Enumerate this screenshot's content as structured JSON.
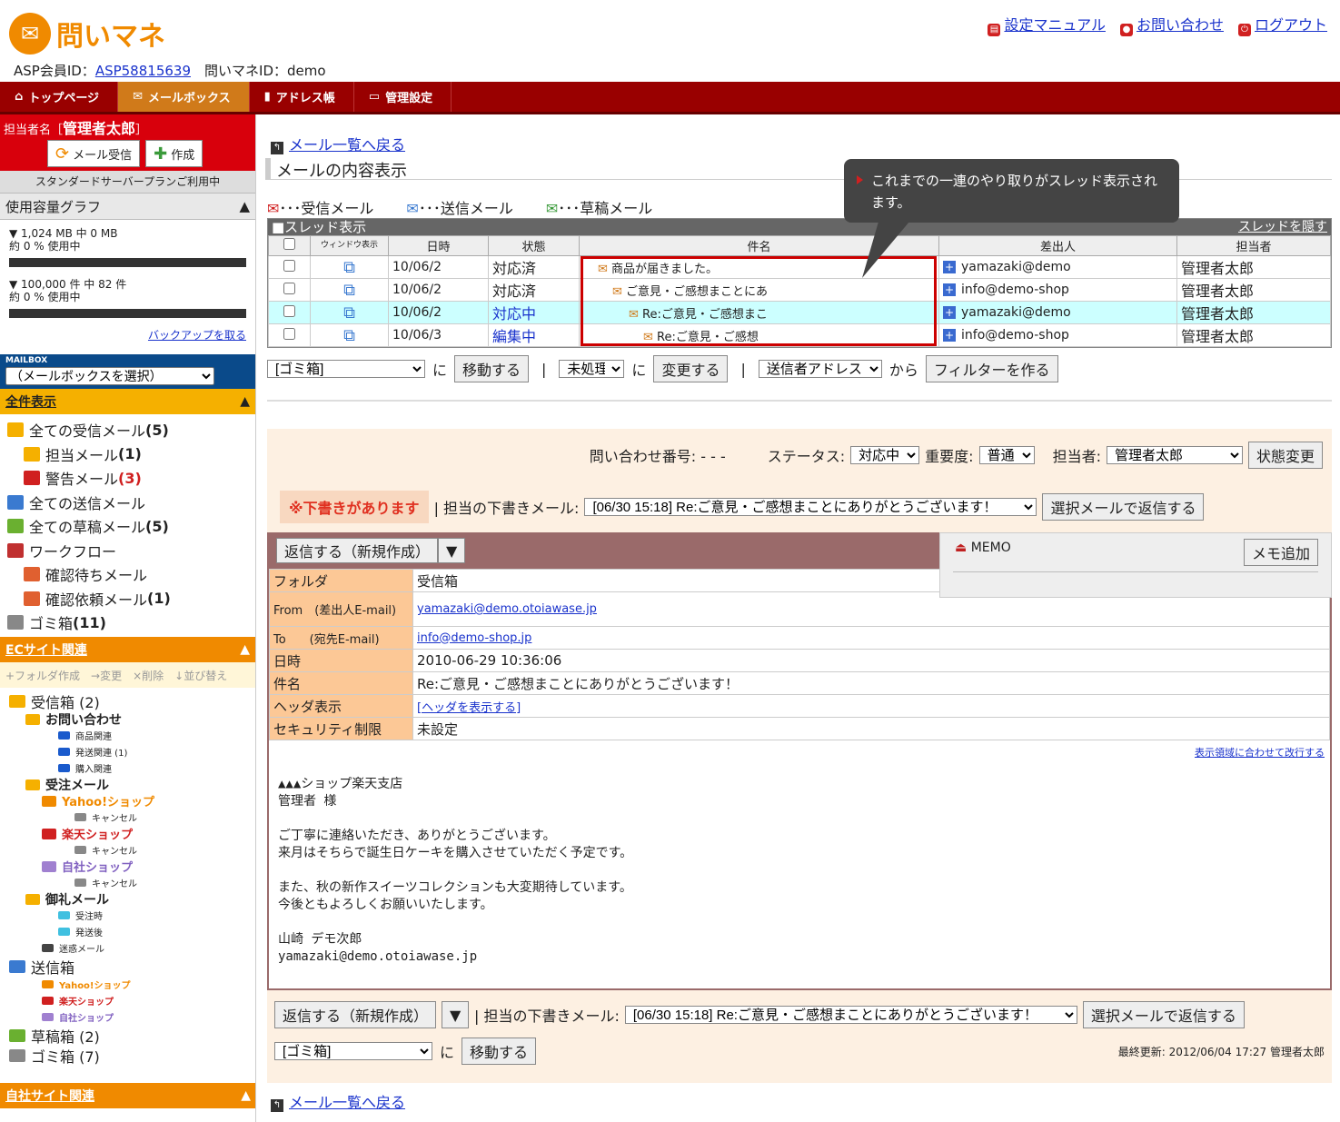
{
  "header": {
    "logo": "問いマネ",
    "asp_label": "ASP会員ID：",
    "asp_id": "ASP58815639",
    "toi_label": "問いマネID：demo",
    "links": [
      "設定マニュアル",
      "お問い合わせ",
      "ログアウト"
    ]
  },
  "nav": [
    "トップページ",
    "メールボックス",
    "アドレス帳",
    "管理設定"
  ],
  "side": {
    "user_label": "担当者名［",
    "user": "管理者太郎",
    "user_end": "］",
    "recv": "メール受信",
    "compose": "作成",
    "plan": "スタンダードサーバープランご利用中",
    "usage_title": "使用容量グラフ",
    "u1a": "▼ 1,024 MB 中 0 MB",
    "u1b": "約 0 % 使用中",
    "u2a": "▼ 100,000 件 中 82 件",
    "u2b": "約 0 % 使用中",
    "backup": "バックアップを取る",
    "mailbox": "MAILBOX",
    "mailbox_sel": "（メールボックスを選択）",
    "all": "全件表示",
    "tree1": [
      {
        "l": "全ての受信メール",
        "c": "(5)",
        "ind": 0,
        "col": "#f5b000"
      },
      {
        "l": "担当メール",
        "c": "(1)",
        "ind": 1,
        "col": "#f5b000"
      },
      {
        "l": "警告メール",
        "c": "(3)",
        "ind": 1,
        "col": "#d02020",
        "red": true
      },
      {
        "l": "全ての送信メール",
        "c": "",
        "ind": 0,
        "col": "#3a7ad0"
      },
      {
        "l": "全ての草稿メール",
        "c": "(5)",
        "ind": 0,
        "col": "#6ab030"
      },
      {
        "l": "ワークフロー",
        "c": "",
        "ind": 0,
        "col": "#c03030"
      },
      {
        "l": "確認待ちメール",
        "c": "",
        "ind": 1,
        "col": "#e06030"
      },
      {
        "l": "確認依頼メール",
        "c": "(1)",
        "ind": 1,
        "col": "#e06030"
      },
      {
        "l": "ゴミ箱",
        "c": "(11)",
        "ind": 0,
        "col": "#888"
      }
    ],
    "ec": "ECサイト関連",
    "tools": "+フォルダ作成　→変更　×削除　↓並び替え",
    "tree2": [
      {
        "l": "受信箱 (2)",
        "ind": 0,
        "col": "#f5b000",
        "fs": 16
      },
      {
        "l": "お問い合わせ",
        "ind": 1,
        "col": "#f5b000",
        "fs": 14,
        "b": true
      },
      {
        "l": "商品関連",
        "ind": 3,
        "col": "#1a5acc",
        "fs": 10
      },
      {
        "l": "発送関連 (1)",
        "ind": 3,
        "col": "#1a5acc",
        "fs": 10
      },
      {
        "l": "購入関連",
        "ind": 3,
        "col": "#1a5acc",
        "fs": 10
      },
      {
        "l": "受注メール",
        "ind": 1,
        "col": "#f5b000",
        "fs": 14,
        "b": true
      },
      {
        "l": "Yahoo!ショップ",
        "ind": 2,
        "col": "#f08a00",
        "fs": 13,
        "b": true,
        "tc": "#f08a00"
      },
      {
        "l": "キャンセル",
        "ind": 4,
        "col": "#888",
        "fs": 10
      },
      {
        "l": "楽天ショップ",
        "ind": 2,
        "col": "#d02020",
        "fs": 13,
        "b": true,
        "tc": "#d02020"
      },
      {
        "l": "キャンセル",
        "ind": 4,
        "col": "#888",
        "fs": 10
      },
      {
        "l": "自社ショップ",
        "ind": 2,
        "col": "#a080d0",
        "fs": 13,
        "b": true,
        "tc": "#8060c0"
      },
      {
        "l": "キャンセル",
        "ind": 4,
        "col": "#888",
        "fs": 10
      },
      {
        "l": "御礼メール",
        "ind": 1,
        "col": "#f5b000",
        "fs": 14,
        "b": true
      },
      {
        "l": "受注時",
        "ind": 3,
        "col": "#40c0e0",
        "fs": 10
      },
      {
        "l": "発送後",
        "ind": 3,
        "col": "#40c0e0",
        "fs": 10
      },
      {
        "l": "迷惑メール",
        "ind": 2,
        "col": "#444",
        "fs": 10
      },
      {
        "l": "送信箱",
        "ind": 0,
        "col": "#3a7ad0",
        "fs": 16
      },
      {
        "l": "Yahoo!ショップ",
        "ind": 2,
        "col": "#f08a00",
        "fs": 10,
        "b": true,
        "tc": "#f08a00"
      },
      {
        "l": "楽天ショップ",
        "ind": 2,
        "col": "#d02020",
        "fs": 10,
        "b": true,
        "tc": "#d02020"
      },
      {
        "l": "自社ショップ",
        "ind": 2,
        "col": "#a080d0",
        "fs": 10,
        "b": true,
        "tc": "#8060c0"
      },
      {
        "l": "草稿箱 (2)",
        "ind": 0,
        "col": "#6ab030",
        "fs": 16
      },
      {
        "l": "ゴミ箱 (7)",
        "ind": 0,
        "col": "#888",
        "fs": 16
      }
    ],
    "own": "自社サイト関連"
  },
  "main": {
    "back": "メール一覧へ戻る",
    "title": "メールの内容表示",
    "legend": [
      "･･･受信メール",
      "･･･送信メール",
      "･･･草稿メール"
    ],
    "callout": "これまでの一連のやり取りがスレッド表示されます。",
    "thread_title": "■スレッド表示",
    "hide": "スレッドを隠す",
    "cols": [
      "",
      "ウィンドウ表示",
      "日時",
      "状態",
      "件名",
      "差出人",
      "担当者"
    ],
    "rows": [
      {
        "date": "10/06/2",
        "st": "対応済",
        "subj": "商品が届きました。",
        "from": "yamazaki@demo",
        "who": "管理者太郎",
        "ind": 16,
        "blue": false,
        "sel": false
      },
      {
        "date": "10/06/2",
        "st": "対応済",
        "subj": "ご意見・ご感想まことにあ",
        "from": "info@demo-shop",
        "who": "管理者太郎",
        "ind": 32,
        "blue": false,
        "sel": false
      },
      {
        "date": "10/06/2",
        "st": "対応中",
        "subj": "Re:ご意見・ご感想まこ",
        "from": "yamazaki@demo",
        "who": "管理者太郎",
        "ind": 50,
        "blue": true,
        "sel": true
      },
      {
        "date": "10/06/3",
        "st": "編集中",
        "subj": "Re:ご意見・ご感想",
        "from": "info@demo-shop",
        "who": "管理者太郎",
        "ind": 66,
        "blue": true,
        "sel": false
      }
    ],
    "trash": "[ゴミ箱]",
    "ni": "に",
    "move": "移動する",
    "unproc": "未処理",
    "change": "変更する",
    "sender": "送信者アドレス",
    "kara": "から",
    "filter": "フィルターを作る",
    "inq": "問い合わせ番号: - - -",
    "st_label": "ステータス:",
    "st_val": "対応中",
    "imp_label": "重要度:",
    "imp_val": "普通",
    "who_label": "担当者:",
    "who_val": "管理者太郎",
    "st_btn": "状態変更",
    "draft_flag": "※下書きがあります",
    "draft_label": "| 担当の下書きメール:",
    "draft_val": "[06/30 15:18] Re:ご意見・ご感想まことにありがとうございます！",
    "reply_sel": "選択メールで返信する",
    "reply": "返信する（新規作成）",
    "memo": "MEMO",
    "memo_add": "メモ追加",
    "fields": [
      {
        "k": "フォルダ",
        "v": "受信箱"
      },
      {
        "k": "From　(差出人E-mail)",
        "v": "yamazaki@demo.otoiawase.jp",
        "link": true
      },
      {
        "k": "To　　(宛先E-mail)",
        "v": "info@demo-shop.jp",
        "link": true
      },
      {
        "k": "日時",
        "v": "2010-06-29 10:36:06"
      },
      {
        "k": "件名",
        "v": "Re:ご意見・ご感想まことにありがとうございます！"
      },
      {
        "k": "ヘッダ表示",
        "v": "[ヘッダを表示する]",
        "link": true
      },
      {
        "k": "セキュリティ制限",
        "v": "未設定"
      }
    ],
    "wrap": "表示領域に合わせて改行する",
    "body": "▲▲▲ショップ楽天支店\n管理者 様\n\nご丁寧に連絡いただき、ありがとうございます。\n来月はそちらで誕生日ケーキを購入させていただく予定です。\n\nまた、秋の新作スイーツコレクションも大変期待しています。\n今後ともよろしくお願いいたします。\n\n山崎 デモ次郎\nyamazaki@demo.otoiawase.jp",
    "updated": "最終更新: 2012/06/04 17:27 管理者太郎"
  }
}
